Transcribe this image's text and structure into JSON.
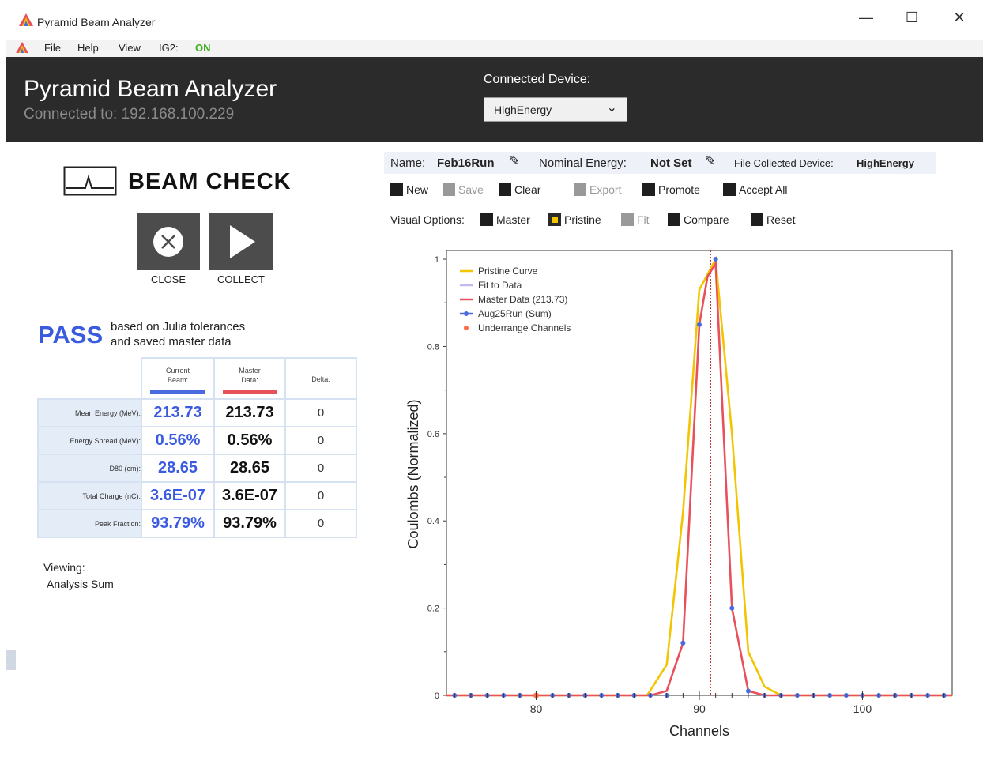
{
  "window": {
    "title": "Pyramid Beam Analyzer",
    "min": "—",
    "max": "☐",
    "close": "✕"
  },
  "menu": {
    "file": "File",
    "help": "Help",
    "view": "View",
    "ig2_label": "IG2:",
    "ig2_status": "ON"
  },
  "header": {
    "app_name": "Pyramid Beam Analyzer",
    "connection": "Connected to: 192.168.100.229",
    "device_label": "Connected Device:",
    "device_value": "HighEnergy"
  },
  "beam_check": {
    "title": "BEAM CHECK",
    "close_label": "CLOSE",
    "collect_label": "COLLECT",
    "result": "PASS",
    "result_note_1": "based on Julia tolerances",
    "result_note_2": "and saved master data",
    "columns": {
      "current_1": "Current",
      "current_2": "Beam:",
      "master_1": "Master",
      "master_2": "Data:",
      "delta": "Delta:"
    },
    "rows": [
      {
        "label": "Mean Energy (MeV):",
        "current": "213.73",
        "master": "213.73",
        "delta": "0"
      },
      {
        "label": "Energy Spread (MeV):",
        "current": "0.56%",
        "master": "0.56%",
        "delta": "0"
      },
      {
        "label": "D80 (cm):",
        "current": "28.65",
        "master": "28.65",
        "delta": "0"
      },
      {
        "label": "Total Charge (nC):",
        "current": "3.6E-07",
        "master": "3.6E-07",
        "delta": "0"
      },
      {
        "label": "Peak Fraction:",
        "current": "93.79%",
        "master": "93.79%",
        "delta": "0"
      }
    ],
    "viewing_label": "Viewing:",
    "viewing_value": "Analysis Sum"
  },
  "info": {
    "name_label": "Name:",
    "name_value": "Feb16Run",
    "energy_label": "Nominal Energy:",
    "energy_value": "Not Set",
    "device_label": "File Collected Device:",
    "device_value": "HighEnergy"
  },
  "toolbar1": {
    "new": "New",
    "save": "Save",
    "clear": "Clear",
    "export": "Export",
    "promote": "Promote",
    "accept_all": "Accept All"
  },
  "toolbar2": {
    "label": "Visual Options:",
    "master": "Master",
    "pristine": "Pristine",
    "fit": "Fit",
    "compare": "Compare",
    "reset": "Reset"
  },
  "colors": {
    "accent": "#3a5be0",
    "header_bg": "#2b2b2b",
    "pristine": "#f2c500",
    "fit": "#c9b8f0",
    "master": "#e8505b",
    "run": "#4a6ae0",
    "underrange": "#ff6a4a",
    "ig2_on": "#3cb01e"
  },
  "chart_data": {
    "type": "line",
    "xlabel": "Channels",
    "ylabel": "Coulombs (Normalized)",
    "xlim": [
      74.5,
      105.5
    ],
    "ylim": [
      0,
      1.02
    ],
    "xticks": [
      80,
      90,
      100
    ],
    "yticks": [
      0,
      0.2,
      0.4,
      0.6,
      0.8,
      1
    ],
    "ytick_labels": [
      "0",
      "0.2",
      "0.4",
      "0.6",
      "0.8",
      "1"
    ],
    "vline_x": 90.7,
    "legend": {
      "position": "top-left",
      "entries": [
        "Pristine Curve",
        "Fit to Data",
        "Master Data (213.73)",
        "Aug25Run (Sum)",
        "Underrange Channels"
      ]
    },
    "series": [
      {
        "name": "Pristine Curve",
        "style": "line",
        "color": "#f2c500",
        "x": [
          74.5,
          86.8,
          88,
          89,
          90,
          91,
          92,
          93,
          94,
          95,
          105.5
        ],
        "y": [
          0,
          0,
          0.07,
          0.42,
          0.93,
          1.0,
          0.6,
          0.1,
          0.02,
          0,
          0
        ]
      },
      {
        "name": "Master Data (213.73)",
        "style": "line",
        "color": "#e8505b",
        "x": [
          74.5,
          87,
          88,
          89,
          90,
          90.5,
          91,
          92,
          93,
          94,
          105.5
        ],
        "y": [
          0,
          0,
          0.01,
          0.12,
          0.85,
          0.96,
          0.99,
          0.2,
          0.01,
          0,
          0
        ]
      },
      {
        "name": "Aug25Run (Sum)",
        "style": "markers",
        "color": "#4a6ae0",
        "x": [
          75,
          76,
          77,
          78,
          79,
          80,
          81,
          82,
          83,
          84,
          85,
          86,
          87,
          88,
          89,
          90,
          91,
          92,
          93,
          94,
          95,
          96,
          97,
          98,
          99,
          100,
          101,
          102,
          103,
          104,
          105
        ],
        "y": [
          0,
          0,
          0,
          0,
          0,
          0,
          0,
          0,
          0,
          0,
          0,
          0,
          0,
          0,
          0.12,
          0.85,
          1.0,
          0.2,
          0.01,
          0,
          0,
          0,
          0,
          0,
          0,
          0,
          0,
          0,
          0,
          0,
          0
        ]
      },
      {
        "name": "Underrange Channels",
        "style": "markers",
        "color": "#ff6a4a",
        "x": [
          80
        ],
        "y": [
          0
        ]
      }
    ]
  }
}
